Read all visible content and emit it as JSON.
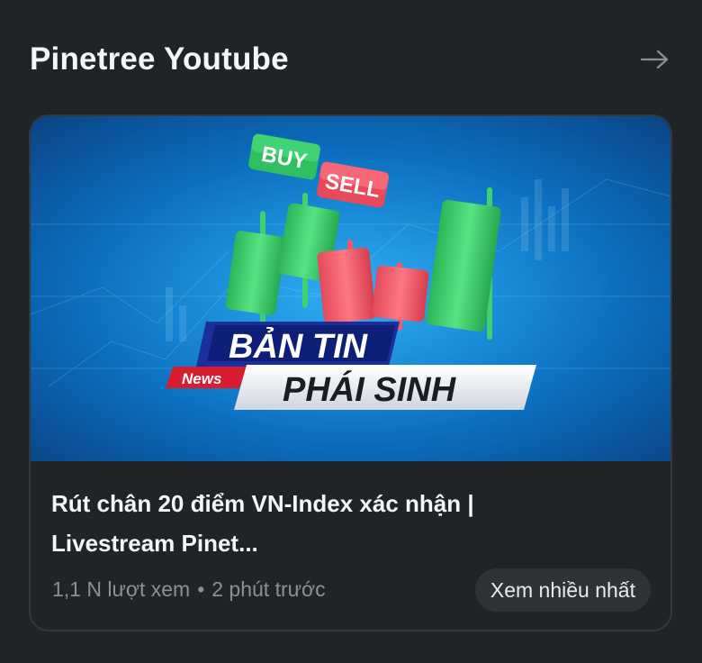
{
  "section": {
    "title": "Pinetree Youtube",
    "arrow_icon": "arrow-right-icon"
  },
  "video": {
    "thumbnail": {
      "buy_label": "BUY",
      "sell_label": "SELL",
      "news_label": "News",
      "headline_line1": "BẢN TIN",
      "headline_line2": "PHÁI SINH",
      "bg_color": "#0b6fc0",
      "up_color": "#3fd26a",
      "down_color": "#ef5a6a"
    },
    "title": "Rút chân 20 điểm VN-Index xác nhận | Livestream Pinet...",
    "views": "1,1 N lượt xem",
    "separator": "•",
    "time_ago": "2 phút trước",
    "badge": "Xem nhiều nhất"
  }
}
